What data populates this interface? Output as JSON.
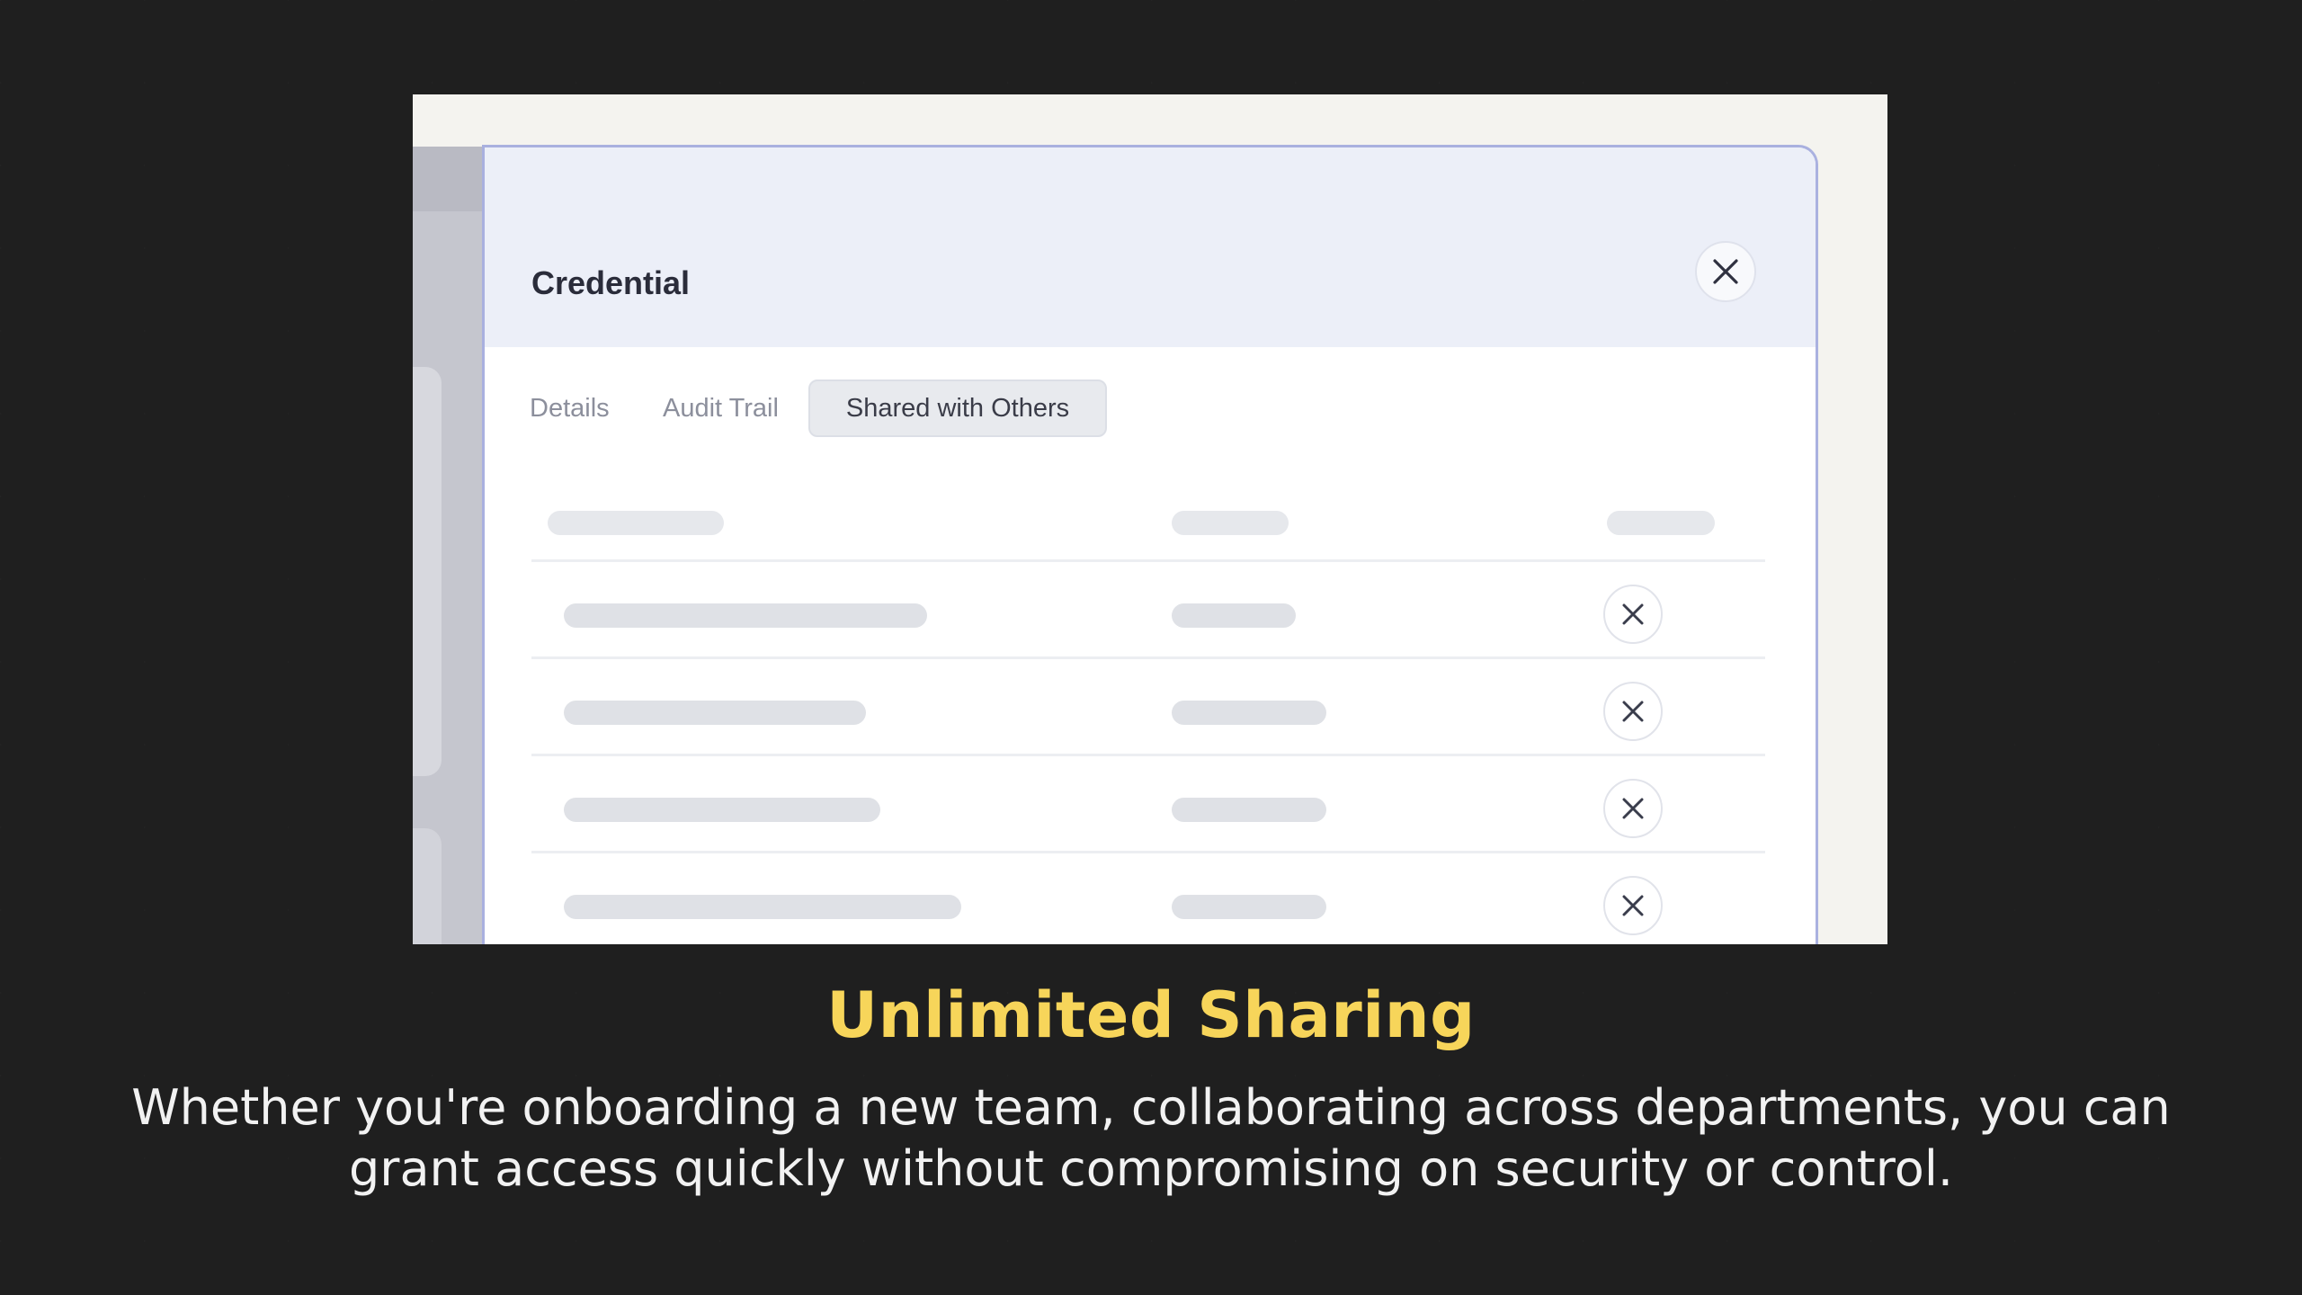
{
  "modal": {
    "title": "Credential",
    "close_icon": "close-icon",
    "tabs": [
      {
        "label": "Details",
        "active": false
      },
      {
        "label": "Audit Trail",
        "active": false
      },
      {
        "label": "Shared with Others",
        "active": true
      }
    ],
    "row_action_icon": "remove-icon",
    "row_count": 4
  },
  "caption": {
    "title": "Unlimited Sharing",
    "line1": "Whether you're onboarding a new team, collaborating across departments, you can",
    "line2": "grant access quickly without compromising on security or control."
  },
  "colors": {
    "background": "#1f1f1f",
    "accent_title": "#f7d55a",
    "caption_text": "#f2f2f2",
    "modal_border": "#a9b0df",
    "modal_header": "#eceff8"
  }
}
